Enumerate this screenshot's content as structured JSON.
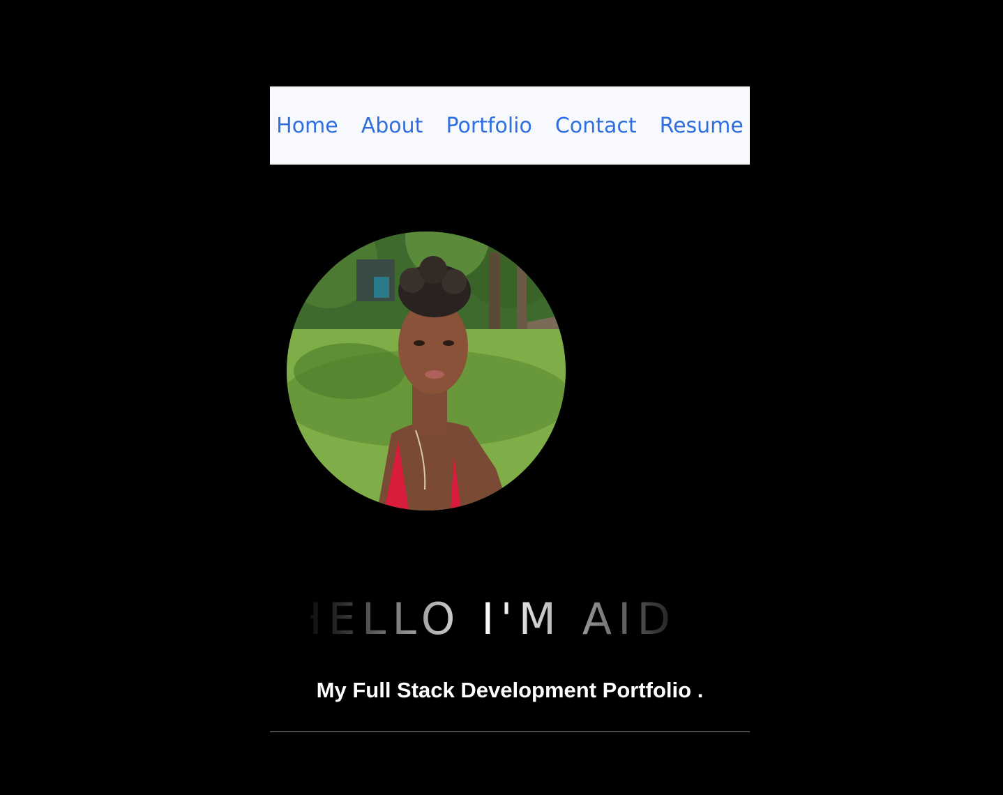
{
  "navbar": {
    "items": [
      {
        "label": "Home"
      },
      {
        "label": "About"
      },
      {
        "label": "Portfolio"
      },
      {
        "label": "Contact"
      },
      {
        "label": "Resume"
      }
    ]
  },
  "hero": {
    "greeting": "HELLO I'M AIDA",
    "subtitle": "My Full Stack Development Portfolio ."
  },
  "colors": {
    "background": "#000000",
    "navbar_background": "#f7f9fc",
    "link": "#2f6fe0",
    "text": "#ffffff"
  }
}
